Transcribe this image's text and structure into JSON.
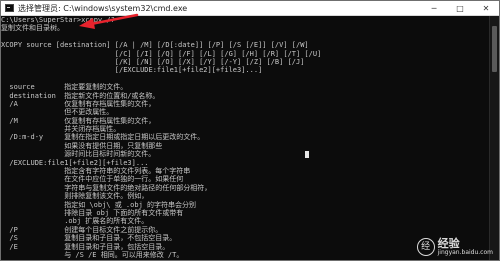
{
  "window": {
    "title": "选择管理员: C:\\windows\\system32\\cmd.exe",
    "controls": {
      "minimize": "─",
      "maximize": "□",
      "close": "✕"
    }
  },
  "console": {
    "lines": [
      "C:\\Users\\SuperStar>xcopy /?",
      "复制文件和目录树。",
      "",
      "XCOPY source [destination] [/A | /M] [/D[:date]] [/P] [/S [/E]] [/V] [/W]",
      "                           [/C] [/I] [/Q] [/F] [/L] [/G] [/H] [/R] [/T] [/U]",
      "                           [/K] [/N] [/O] [/X] [/Y] [/-Y] [/Z] [/B] [/J]",
      "                           [/EXCLUDE:file1[+file2][+file3]...]",
      "",
      "  source       指定要复制的文件。",
      "  destination  指定新文件的位置和/或名称。",
      "  /A           仅复制有存档属性集的文件，",
      "               但不更改属性。",
      "  /M           仅复制有存档属性集的文件，",
      "               并关闭存档属性。",
      "  /D:m-d-y     复制在指定日期或指定日期以后更改的文件。",
      "               如果没有提供日期，只复制那些",
      "               源时间比目标时间新的文件。",
      "  /EXCLUDE:file1[+file2][+file3]...",
      "               指定含有字符串的文件列表。每个字符串",
      "               在文件中应位于单独的一行。如果任何",
      "               字符串与复制文件的绝对路径的任何部分相符，",
      "               则排除复制该文件。例如，",
      "               指定如 \\obj\\ 或 .obj 的字符串会分别",
      "               排除目录 obj 下面的所有文件或带有",
      "               .obj 扩展名的所有文件。",
      "  /P           创建每个目标文件之前提示你。",
      "  /S           复制目录和子目录，不包括空目录。",
      "  /E           复制目录和子目录，包括空目录。",
      "               与 /S /E 相同。可以用来修改 /T。"
    ]
  },
  "watermark": {
    "logo_glyph": "经",
    "main": "经验",
    "sub": "jingyan.baidu.com"
  },
  "icons": {
    "app": "cmd-icon",
    "arrow": "red-annotation-arrow"
  },
  "colors": {
    "console_bg": "#0c0c0c",
    "console_fg": "#c8c8c8",
    "arrow": "#e8232d"
  }
}
